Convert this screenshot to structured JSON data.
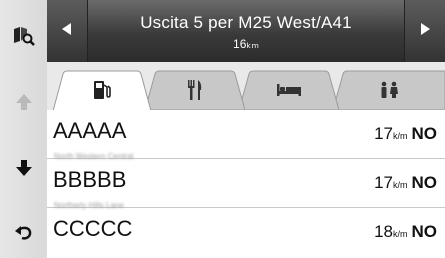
{
  "header": {
    "title": "Uscita 5 per M25 West/A41",
    "subtitle": "16ₖₘ"
  },
  "tabs": [
    {
      "name": "gas",
      "icon": "gas-pump-icon",
      "selected": true
    },
    {
      "name": "food",
      "icon": "fork-knife-icon",
      "selected": false
    },
    {
      "name": "lodging",
      "icon": "bed-icon",
      "selected": false
    },
    {
      "name": "restroom",
      "icon": "restroom-icon",
      "selected": false
    }
  ],
  "rows": [
    {
      "name": "AAAAA",
      "address": "North Western Central",
      "distance": "17",
      "unit": "k/m",
      "status": "NO"
    },
    {
      "name": "BBBBB",
      "address": "Northerly Hills Lane",
      "distance": "17",
      "unit": "k/m",
      "status": "NO"
    },
    {
      "name": "CCCCC",
      "address": "",
      "distance": "18",
      "unit": "k/m",
      "status": "NO"
    }
  ],
  "rail": {
    "icons": [
      "map-search-icon",
      "arrow-up-icon",
      "arrow-down-icon",
      "back-icon"
    ]
  },
  "colors": {
    "header_bg": "#3a3a3a",
    "tab_selected": "#ffffff",
    "tab_unselected": "#c8c8c8"
  }
}
